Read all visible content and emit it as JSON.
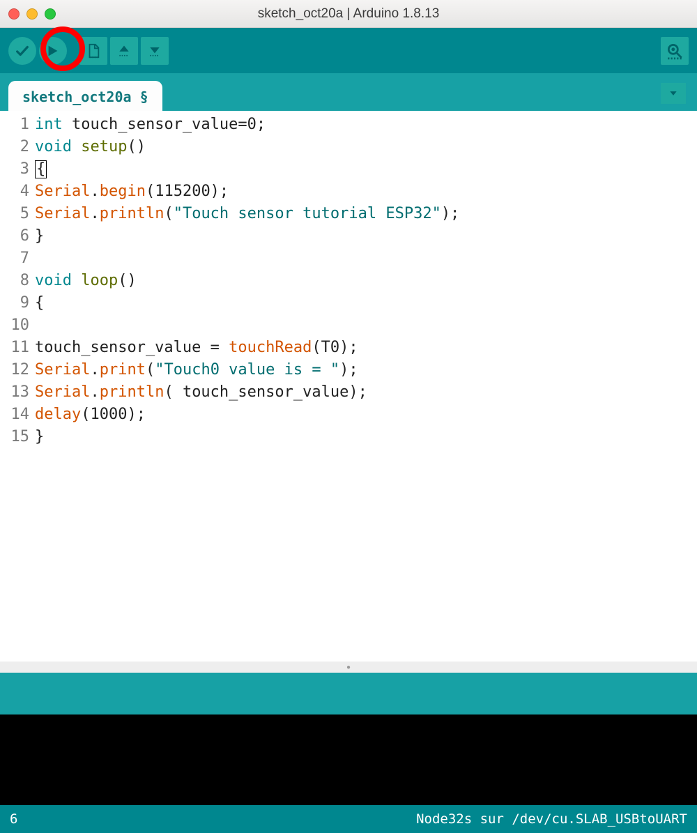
{
  "window": {
    "title": "sketch_oct20a | Arduino 1.8.13"
  },
  "tab": {
    "label": "sketch_oct20a §"
  },
  "code": {
    "lines": [
      {
        "n": "1",
        "tokens": [
          [
            "type",
            "int"
          ],
          [
            "plain",
            " touch_sensor_value=0;"
          ]
        ]
      },
      {
        "n": "2",
        "tokens": [
          [
            "type",
            "void"
          ],
          [
            "plain",
            " "
          ],
          [
            "kw",
            "setup"
          ],
          [
            "plain",
            "()"
          ]
        ]
      },
      {
        "n": "3",
        "tokens": [
          [
            "curbrace",
            "{"
          ]
        ]
      },
      {
        "n": "4",
        "tokens": [
          [
            "obj",
            "Serial"
          ],
          [
            "plain",
            "."
          ],
          [
            "func",
            "begin"
          ],
          [
            "plain",
            "(115200);"
          ]
        ]
      },
      {
        "n": "5",
        "tokens": [
          [
            "obj",
            "Serial"
          ],
          [
            "plain",
            "."
          ],
          [
            "func",
            "println"
          ],
          [
            "plain",
            "("
          ],
          [
            "str",
            "\"Touch sensor tutorial ESP32\""
          ],
          [
            "plain",
            ");"
          ]
        ]
      },
      {
        "n": "6",
        "tokens": [
          [
            "plain",
            "}"
          ]
        ]
      },
      {
        "n": "7",
        "tokens": [
          [
            "plain",
            ""
          ]
        ]
      },
      {
        "n": "8",
        "tokens": [
          [
            "type",
            "void"
          ],
          [
            "plain",
            " "
          ],
          [
            "kw",
            "loop"
          ],
          [
            "plain",
            "()"
          ]
        ]
      },
      {
        "n": "9",
        "tokens": [
          [
            "plain",
            "{"
          ]
        ]
      },
      {
        "n": "10",
        "tokens": [
          [
            "plain",
            ""
          ]
        ]
      },
      {
        "n": "11",
        "tokens": [
          [
            "plain",
            "touch_sensor_value = "
          ],
          [
            "func",
            "touchRead"
          ],
          [
            "plain",
            "(T0);"
          ]
        ]
      },
      {
        "n": "12",
        "tokens": [
          [
            "obj",
            "Serial"
          ],
          [
            "plain",
            "."
          ],
          [
            "func",
            "print"
          ],
          [
            "plain",
            "("
          ],
          [
            "str",
            "\"Touch0 value is = \""
          ],
          [
            "plain",
            ");"
          ]
        ]
      },
      {
        "n": "13",
        "tokens": [
          [
            "obj",
            "Serial"
          ],
          [
            "plain",
            "."
          ],
          [
            "func",
            "println"
          ],
          [
            "plain",
            "( touch_sensor_value);"
          ]
        ]
      },
      {
        "n": "14",
        "tokens": [
          [
            "func",
            "delay"
          ],
          [
            "plain",
            "(1000);"
          ]
        ]
      },
      {
        "n": "15",
        "tokens": [
          [
            "plain",
            "}"
          ]
        ]
      }
    ]
  },
  "footer": {
    "left": "6",
    "right": "Node32s sur /dev/cu.SLAB_USBtoUART"
  }
}
